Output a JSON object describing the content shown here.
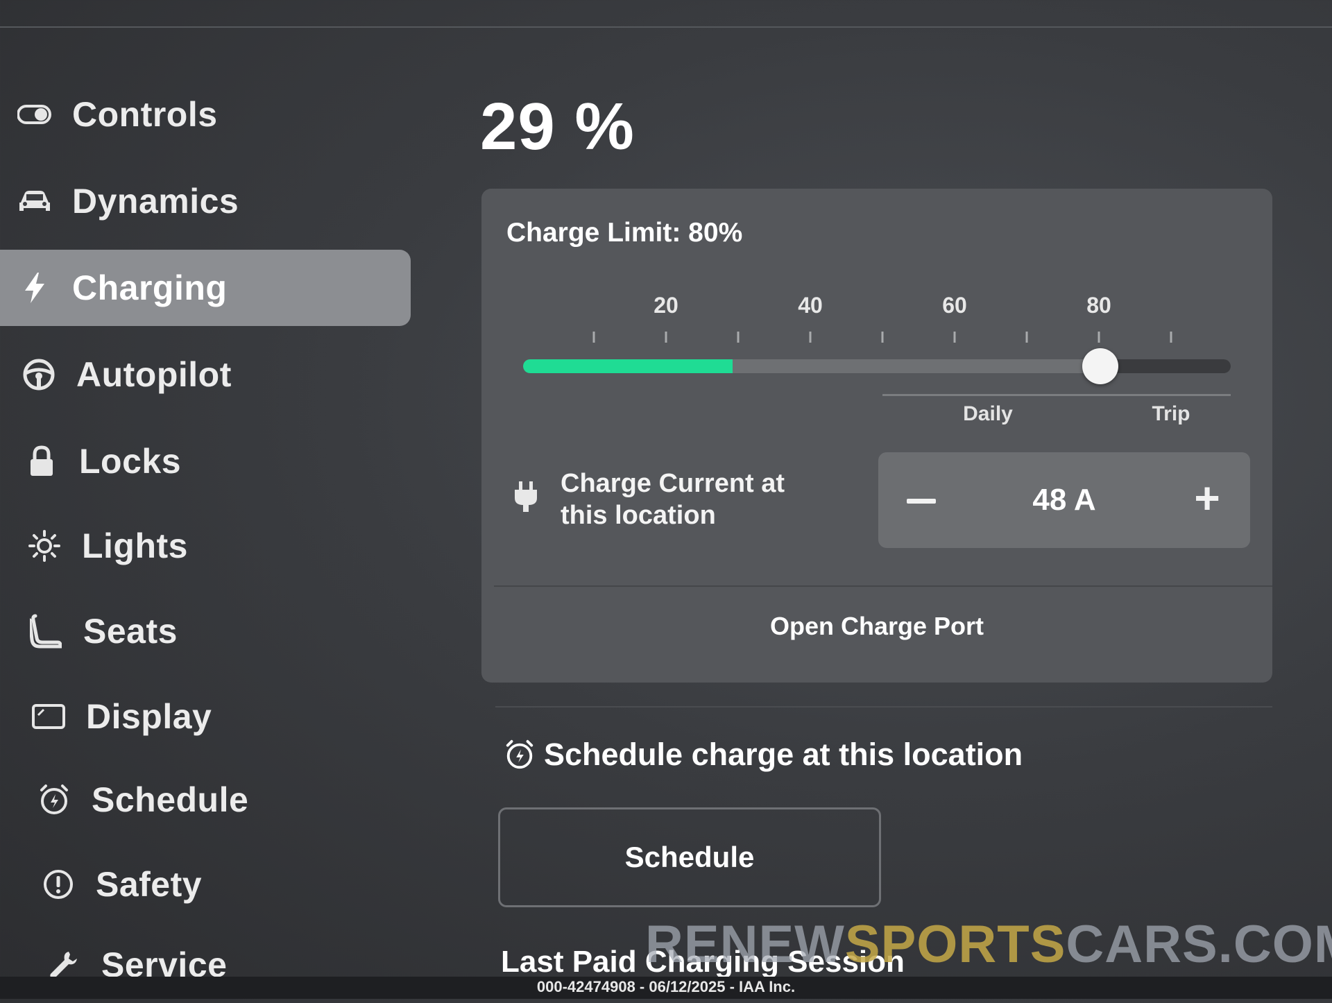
{
  "sidebar": {
    "items": [
      {
        "label": "Controls",
        "icon": "toggle-icon"
      },
      {
        "label": "Dynamics",
        "icon": "car-icon"
      },
      {
        "label": "Charging",
        "icon": "lightning-bolt-icon",
        "active": true
      },
      {
        "label": "Autopilot",
        "icon": "steering-wheel-icon"
      },
      {
        "label": "Locks",
        "icon": "lock-icon"
      },
      {
        "label": "Lights",
        "icon": "sun-icon"
      },
      {
        "label": "Seats",
        "icon": "seat-icon"
      },
      {
        "label": "Display",
        "icon": "display-icon"
      },
      {
        "label": "Schedule",
        "icon": "alarm-clock-icon"
      },
      {
        "label": "Safety",
        "icon": "alert-circle-icon"
      },
      {
        "label": "Service",
        "icon": "wrench-icon"
      }
    ]
  },
  "battery": {
    "percent_label": "29 %",
    "level": 29
  },
  "charge_card": {
    "limit_label": "Charge Limit: 80%",
    "limit_value": 80,
    "scale_labels": [
      "20",
      "40",
      "60",
      "80"
    ],
    "daily_label": "Daily",
    "trip_label": "Trip",
    "current_label": "Charge Current at this location",
    "current_value": "48 A",
    "open_port_label": "Open Charge Port"
  },
  "schedule": {
    "heading": "Schedule charge at this location",
    "button_label": "Schedule"
  },
  "last_paid": {
    "heading": "Last Paid Charging Session"
  },
  "watermark": {
    "part1": "RENEW",
    "part2": "SPORTS",
    "part3": "CARS.COM"
  },
  "footer": {
    "text": "000-42474908 - 06/12/2025 - IAA Inc."
  },
  "colors": {
    "charge_fill": "#1fdc94",
    "card_bg": "#55575b",
    "active_item": "#8c8e92"
  }
}
